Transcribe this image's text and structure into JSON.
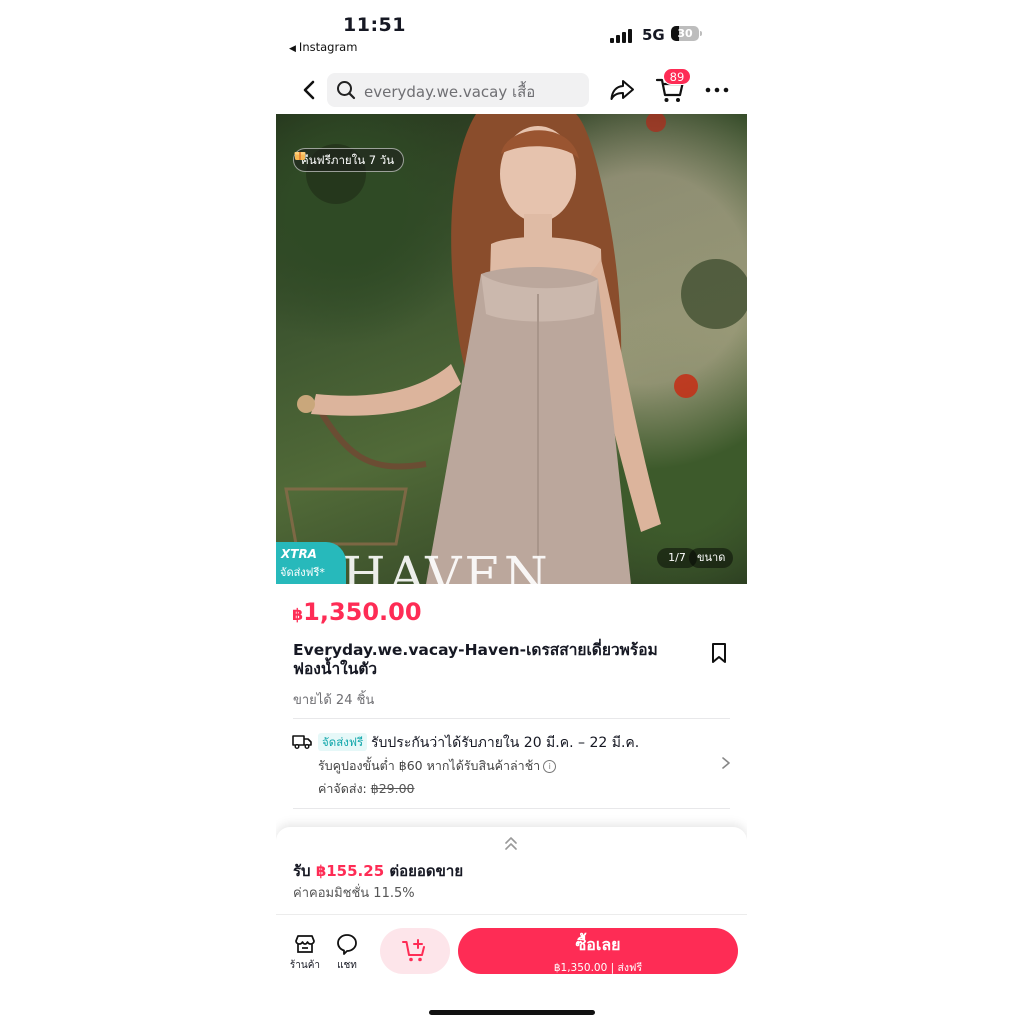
{
  "status_bar": {
    "time": "11:51",
    "back_app": "Instagram",
    "network": "5G",
    "battery": "30",
    "battery_level": 0.3
  },
  "header": {
    "search_text": "everyday.we.vacay เสื้อ",
    "cart_count": "89"
  },
  "hero": {
    "return_badge": "คืนฟรีภายใน 7 วัน",
    "xtra_label": "XTRA",
    "xtra_sub": "จัดส่งฟรี*",
    "overlay_text": "HAVEN",
    "image_counter": "1/7",
    "size_label": "ขนาด"
  },
  "product": {
    "currency": "฿",
    "price": "1,350.00",
    "title": "Everyday.we.vacay-Haven-เดรสสายเดี่ยวพร้อมฟองน้ำในตัว",
    "sold": "ขายได้ 24 ชิ้น"
  },
  "shipping": {
    "tag": "จัดส่งฟรี",
    "guarantee": "รับประกันว่าได้รับภายใน 20 มี.ค. – 22 มี.ค.",
    "coupon": "รับคูปองขั้นต่ำ ฿60 หากได้รับสินค้าล่าช้า",
    "fee_label": "ค่าจัดส่ง:",
    "fee_value": "฿29.00"
  },
  "commission": {
    "earn_prefix": "รับ",
    "earn_amount": "฿155.25",
    "earn_suffix": "ต่อยอดขาย",
    "rate": "ค่าคอมมิชชั่น 11.5%"
  },
  "bottom_bar": {
    "shop_label": "ร้านค้า",
    "chat_label": "แชท",
    "buy_label": "ซื้อเลย",
    "buy_sub": "฿1,350.00 | ส่งฟรี"
  },
  "colors": {
    "accent": "#fe2c55",
    "teal": "#27b9bb"
  }
}
